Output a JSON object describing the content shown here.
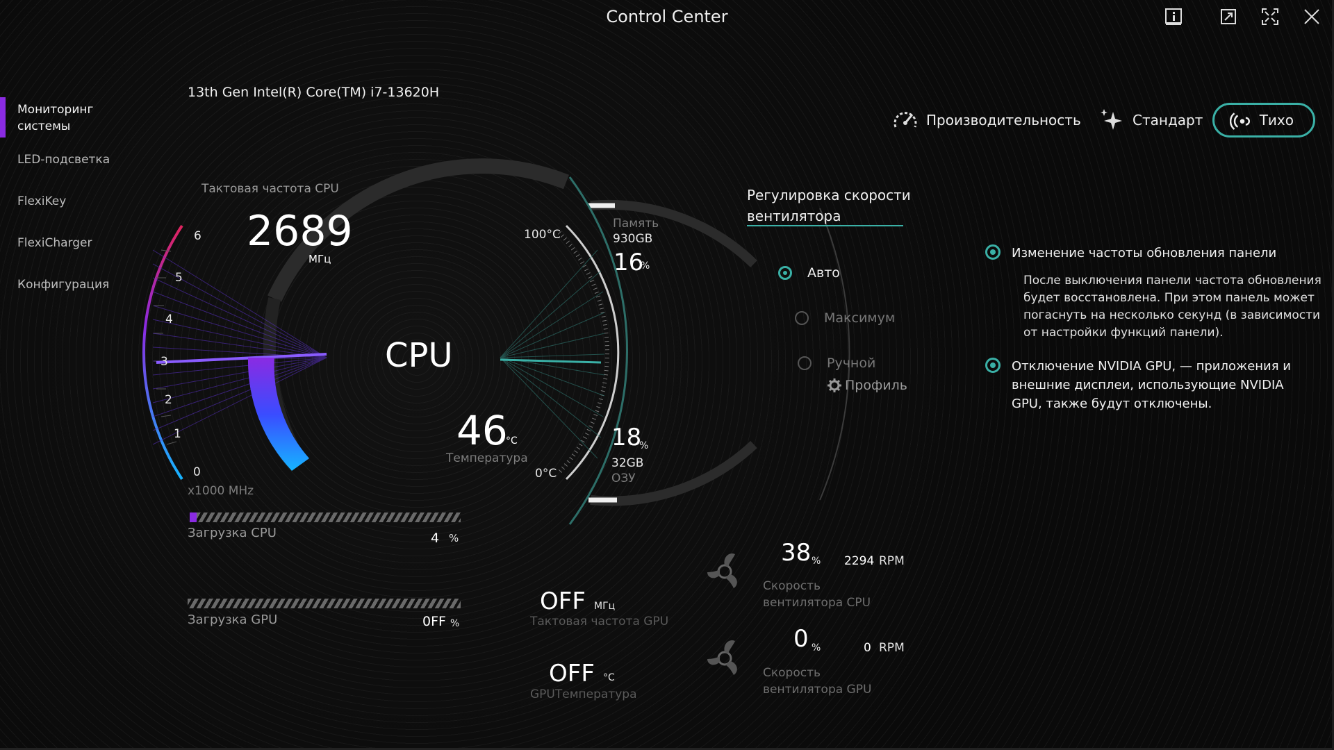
{
  "window": {
    "title": "Control Center"
  },
  "sidebar": {
    "items": [
      {
        "label": "Мониторинг системы",
        "active": true
      },
      {
        "label": "LED-подсветка"
      },
      {
        "label": "FlexiKey"
      },
      {
        "label": "FlexiCharger"
      },
      {
        "label": "Конфигурация"
      }
    ],
    "accent_color": "#8a2be2"
  },
  "cpu": {
    "name": "13th Gen Intel(R) Core(TM) i7-13620H",
    "clock_label": "Тактовая частота CPU",
    "clock_value": "2689",
    "clock_unit": "МГц",
    "scale_ticks": [
      "6",
      "5",
      "4",
      "3",
      "2",
      "1",
      "0"
    ],
    "scale_unit": "x1000 MHz",
    "center_label": "CPU",
    "temp_value": "46",
    "temp_unit": "°C",
    "temp_label": "Температура",
    "temp_max": "100°C",
    "temp_min": "0°C",
    "load_label": "Загрузка CPU",
    "load_value": "4",
    "load_unit": "%",
    "load_fraction": 0.04
  },
  "memory": {
    "label": "Память",
    "size": "930GB",
    "percent": "16",
    "percent_unit": "%"
  },
  "ram": {
    "label": "ОЗУ",
    "size": "32GB",
    "percent": "18",
    "percent_unit": "%"
  },
  "gpu": {
    "load_label": "Загрузка GPU",
    "load_value": "0FF",
    "load_unit": "%",
    "clock_value": "OFF",
    "clock_unit": "МГц",
    "clock_label": "Тактовая частота GPU",
    "temp_value": "OFF",
    "temp_unit": "°C",
    "temp_label": "GPUТемпература"
  },
  "modes": [
    {
      "label": "Производительность",
      "icon": "speedometer-icon",
      "active": false
    },
    {
      "label": "Стандарт",
      "icon": "sparkle-icon",
      "active": false
    },
    {
      "label": "Тихо",
      "icon": "quiet-icon",
      "active": true
    }
  ],
  "fan_control": {
    "title_line1": "Регулировка скорости",
    "title_line2": "вентилятора",
    "options": [
      {
        "label": "Авто",
        "selected": true
      },
      {
        "label": "Максимум",
        "selected": false
      },
      {
        "label": "Ручной",
        "selected": false
      }
    ],
    "profile_label": "Профиль"
  },
  "fans": {
    "cpu": {
      "percent": "38",
      "percent_unit": "%",
      "rpm": "2294",
      "rpm_unit": "RPM",
      "label_line1": "Скорость",
      "label_line2": "вентилятора CPU"
    },
    "gpu": {
      "percent": "0",
      "percent_unit": "%",
      "rpm": "0",
      "rpm_unit": "RPM",
      "label_line1": "Скорость",
      "label_line2": "вентилятора GPU"
    }
  },
  "options": [
    {
      "title": "Изменение частоты обновления панели",
      "description": "После выключения панели частота обновления будет восстановлена. При этом панель может погаснуть на несколько секунд (в зависимости от настройки функций панели)."
    },
    {
      "title": "Отключение NVIDIA GPU, — приложения и внешние дисплеи, использующие NVIDIA GPU, также будут отключены."
    }
  ],
  "colors": {
    "accent": "#3ab0a6",
    "cpu_gradient_top": "#8a2be2",
    "cpu_gradient_bottom": "#1e90ff"
  }
}
